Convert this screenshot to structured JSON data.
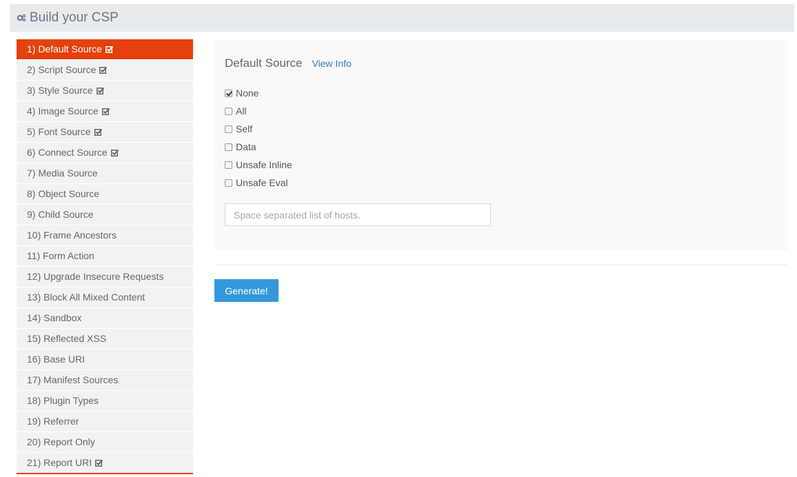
{
  "header": {
    "title": "Build your CSP",
    "icon": "gears-icon"
  },
  "sidebar": {
    "items": [
      {
        "label": "1) Default Source",
        "checked": true,
        "active": true
      },
      {
        "label": "2) Script Source",
        "checked": true
      },
      {
        "label": "3) Style Source",
        "checked": true
      },
      {
        "label": "4) Image Source",
        "checked": true
      },
      {
        "label": "5) Font Source",
        "checked": true
      },
      {
        "label": "6) Connect Source",
        "checked": true
      },
      {
        "label": "7) Media Source",
        "checked": false
      },
      {
        "label": "8) Object Source",
        "checked": false
      },
      {
        "label": "9) Child Source",
        "checked": false
      },
      {
        "label": "10) Frame Ancestors",
        "checked": false
      },
      {
        "label": "11) Form Action",
        "checked": false
      },
      {
        "label": "12) Upgrade Insecure Requests",
        "checked": false
      },
      {
        "label": "13) Block All Mixed Content",
        "checked": false
      },
      {
        "label": "14) Sandbox",
        "checked": false
      },
      {
        "label": "15) Reflected XSS",
        "checked": false
      },
      {
        "label": "16) Base URI",
        "checked": false
      },
      {
        "label": "17) Manifest Sources",
        "checked": false
      },
      {
        "label": "18) Plugin Types",
        "checked": false
      },
      {
        "label": "19) Referrer",
        "checked": false
      },
      {
        "label": "20) Report Only",
        "checked": false
      },
      {
        "label": "21) Report URI",
        "checked": true
      }
    ]
  },
  "panel": {
    "title": "Default Source",
    "view_info": "View Info",
    "options": [
      {
        "label": "None",
        "checked": true
      },
      {
        "label": "All",
        "checked": false
      },
      {
        "label": "Self",
        "checked": false
      },
      {
        "label": "Data",
        "checked": false
      },
      {
        "label": "Unsafe Inline",
        "checked": false
      },
      {
        "label": "Unsafe Eval",
        "checked": false
      }
    ],
    "hosts_placeholder": "Space separated list of hosts.",
    "hosts_value": ""
  },
  "actions": {
    "generate_label": "Generate!"
  },
  "colors": {
    "accent": "#e4410e",
    "button": "#3498db",
    "link": "#337ab7"
  }
}
